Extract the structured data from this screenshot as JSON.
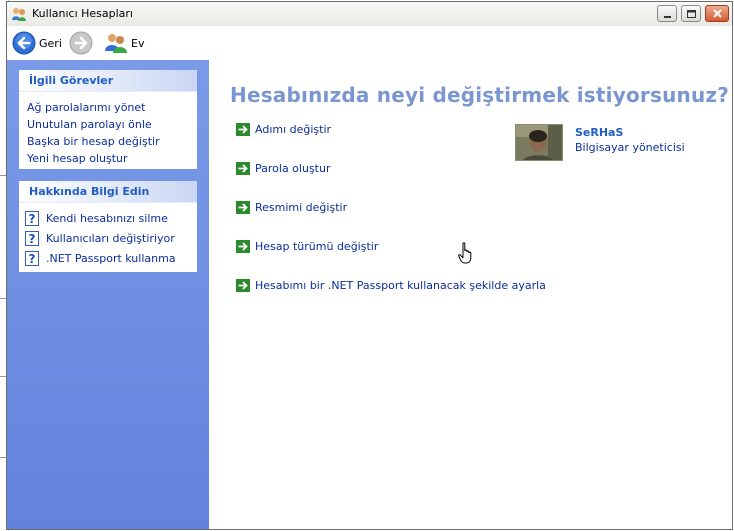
{
  "window": {
    "title": "Kullanıcı Hesapları"
  },
  "toolbar": {
    "back_label": "Geri",
    "home_label": "Ev"
  },
  "sidebar": {
    "related_tasks": {
      "title": "İlgili Görevler",
      "items": [
        "Ağ parolalarımı yönet",
        "Unutulan parolayı önle",
        "Başka bir hesap değiştir",
        "Yeni hesap oluştur"
      ]
    },
    "learn_about": {
      "title": "Hakkında Bilgi Edin",
      "items": [
        "Kendi hesabınızı silme",
        "Kullanıcıları değiştiriyor",
        ".NET Passport kullanma"
      ]
    }
  },
  "main": {
    "heading": "Hesabınızda neyi değiştirmek istiyorsunuz?",
    "options": [
      "Adımı değiştir",
      "Parola oluştur",
      "Resmimi değiştir",
      "Hesap türümü değiştir",
      "Hesabımı bir .NET Passport kullanacak şekilde ayarla"
    ]
  },
  "user": {
    "name": "SeRHaS",
    "role": "Bilgisayar yöneticisi"
  },
  "colors": {
    "sidebar_gradient": "#6f8fe3",
    "heading": "#7a96d0",
    "link": "#0c2d9c",
    "panel_title": "#215dc6",
    "option_arrow": "#2b8a2b"
  },
  "icons": {
    "title": "users-icon",
    "back": "back-arrow-icon",
    "forward": "forward-arrow-icon",
    "home": "users-home-icon",
    "option": "green-arrow-icon",
    "help": "question-mark-icon"
  }
}
